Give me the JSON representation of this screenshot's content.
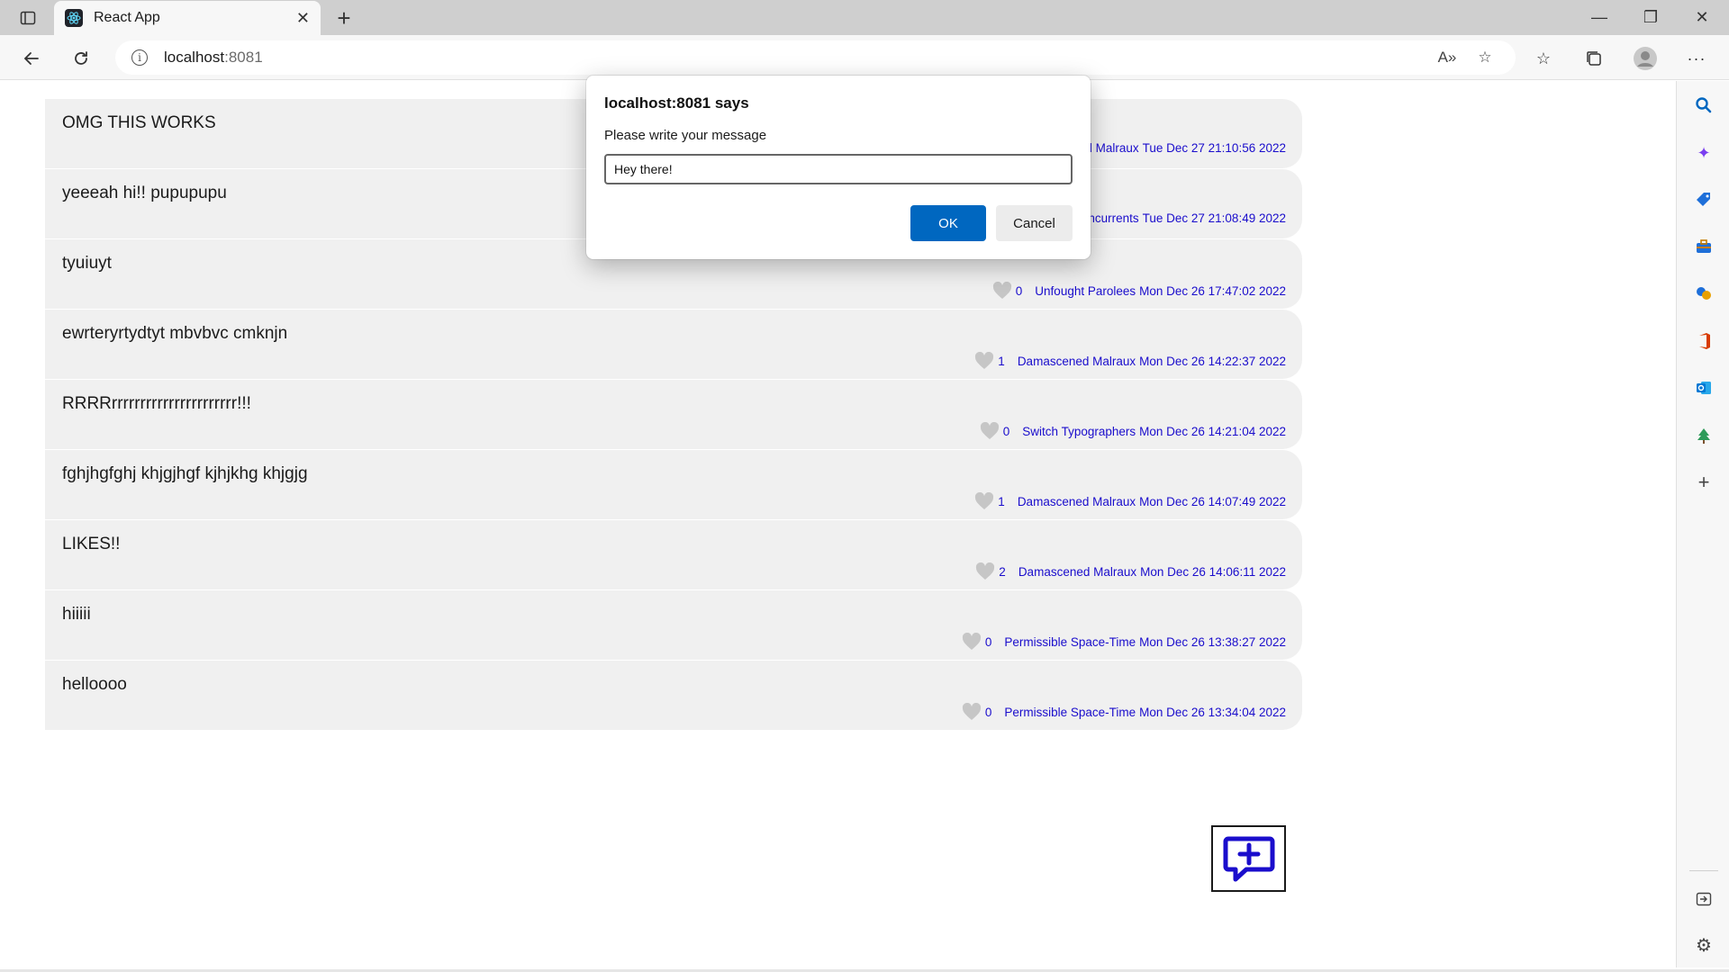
{
  "browser": {
    "tab_title": "React App",
    "address_host": "localhost",
    "address_port": ":8081",
    "tab_icon": "react-logo-icon",
    "colors": {
      "tabbar": "#cfcfcf",
      "toolbar": "#f7f7f7"
    }
  },
  "messages": [
    {
      "text": "OMG THIS WORKS",
      "likes": "",
      "author": "Damascened Malraux",
      "date": "Tue Dec 27 21:10:56 2022"
    },
    {
      "text": "yeeeah hi!! pupupupu",
      "likes": "",
      "author": "Rude Concurrents",
      "date": "Tue Dec 27 21:08:49 2022"
    },
    {
      "text": "tyuiuyt",
      "likes": "0",
      "author": "Unfought Parolees",
      "date": "Mon Dec 26 17:47:02 2022"
    },
    {
      "text": "ewrteryrtydtyt mbvbvc cmknjn",
      "likes": "1",
      "author": "Damascened Malraux",
      "date": "Mon Dec 26 14:22:37 2022"
    },
    {
      "text": "RRRRrrrrrrrrrrrrrrrrrrrrrr!!!",
      "likes": "0",
      "author": "Switch Typographers",
      "date": "Mon Dec 26 14:21:04 2022"
    },
    {
      "text": "fghjhgfghj khjgjhgf kjhjkhg khjgjg",
      "likes": "1",
      "author": "Damascened Malraux",
      "date": "Mon Dec 26 14:07:49 2022"
    },
    {
      "text": "LIKES!!",
      "likes": "2",
      "author": "Damascened Malraux",
      "date": "Mon Dec 26 14:06:11 2022"
    },
    {
      "text": "hiiiii",
      "likes": "0",
      "author": "Permissible Space-Time",
      "date": "Mon Dec 26 13:38:27 2022"
    },
    {
      "text": "helloooo",
      "likes": "0",
      "author": "Permissible Space-Time",
      "date": "Mon Dec 26 13:34:04 2022"
    }
  ],
  "new_message_button": {
    "icon": "message-plus-icon",
    "color": "#1a0dcc"
  },
  "dialog": {
    "title": "localhost:8081 says",
    "message": "Please write your message",
    "input_value": "Hey there!",
    "ok_label": "OK",
    "cancel_label": "Cancel",
    "ok_color": "#0067c0"
  }
}
